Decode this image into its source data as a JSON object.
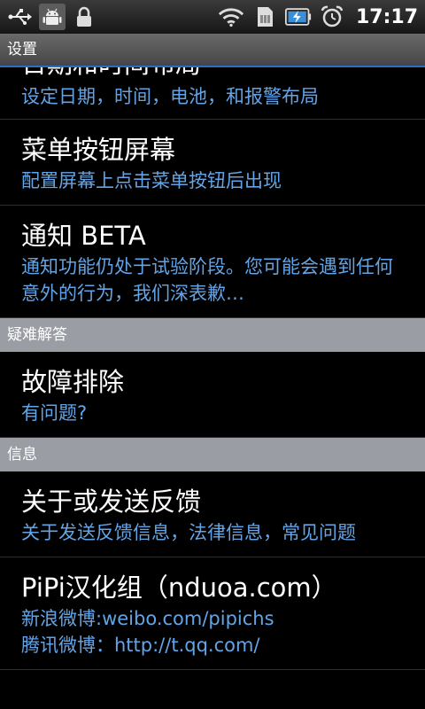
{
  "status_bar": {
    "time": "17:17",
    "icons": [
      "usb-icon",
      "android-debug-icon",
      "lock-icon",
      "wifi-icon",
      "sim-icon",
      "battery-charging-icon",
      "alarm-clock-icon"
    ]
  },
  "title_bar": {
    "title": "设置"
  },
  "items_top": [
    {
      "title": "日期和时间布局",
      "summary": "设定日期，时间，电池，和报警布局"
    },
    {
      "title": "菜单按钮屏幕",
      "summary": "配置屏幕上点击菜单按钮后出现"
    },
    {
      "title": "通知 BETA",
      "summary": "通知功能仍处于试验阶段。您可能会遇到任何意外的行为，我们深表歉…"
    }
  ],
  "sections": {
    "troubleshooting": "疑难解答",
    "info": "信息"
  },
  "troubleshooting_items": [
    {
      "title": "故障排除",
      "summary": "有问题?"
    }
  ],
  "info_items": [
    {
      "title": "关于或发送反馈",
      "summary": "关于发送反馈信息，法律信息，常见问题"
    },
    {
      "title": "PiPi汉化组（nduoa.com）",
      "summary_line1": "新浪微博:weibo.com/pipichs",
      "summary_line2": "腾讯微博：http://t.qq.com/"
    }
  ],
  "colors": {
    "summary": "#63a4e6",
    "section_bg": "#9a9ea4",
    "title_underline": "#2b6fc4"
  }
}
